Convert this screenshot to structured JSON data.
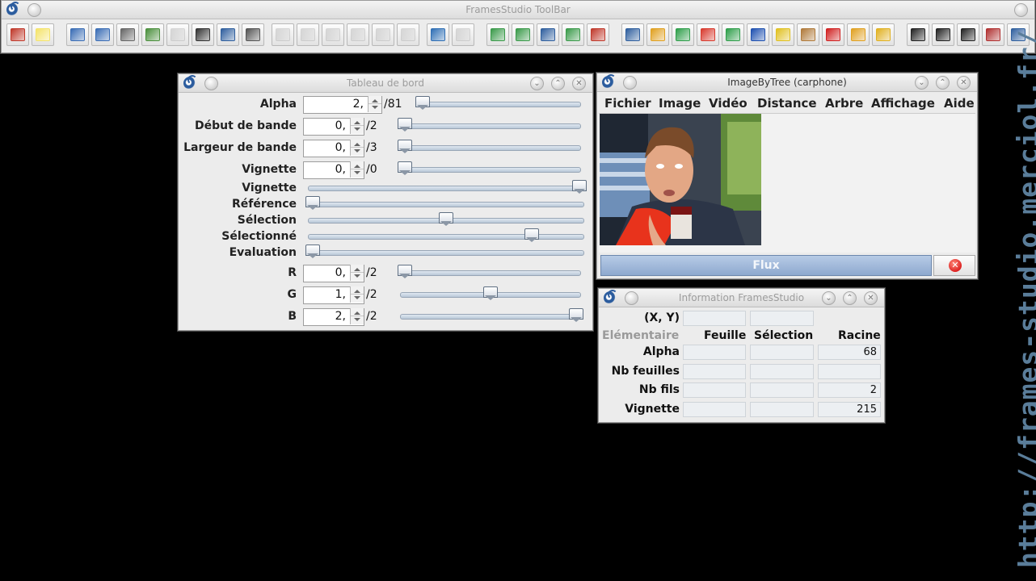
{
  "toolbar_window": {
    "title": "FramesStudio ToolBar",
    "buttons": [
      {
        "name": "exit-icon",
        "color": "#c0392b"
      },
      {
        "name": "new-document-icon",
        "color": "#f4e36a"
      },
      {
        "name": "open-image-icon",
        "color": "#3a6db5"
      },
      {
        "name": "open-sequence-icon",
        "color": "#3a6db5"
      },
      {
        "name": "camera-icon",
        "color": "#666666"
      },
      {
        "name": "screen-capture-icon",
        "color": "#4a8f3c"
      },
      {
        "name": "capture-disabled-icon",
        "color": "#9b9b9b"
      },
      {
        "name": "film-icon",
        "color": "#333333"
      },
      {
        "name": "list-icon",
        "color": "#2f5f9e"
      },
      {
        "name": "webcam-icon",
        "color": "#555555"
      },
      {
        "name": "play-icon",
        "color": "#9b9b9b"
      },
      {
        "name": "redo-icon",
        "color": "#9b9b9b"
      },
      {
        "name": "stop-icon",
        "color": "#9b9b9b"
      },
      {
        "name": "light-icon",
        "color": "#9b9b9b"
      },
      {
        "name": "pen-icon",
        "color": "#9b9b9b"
      },
      {
        "name": "hat-icon",
        "color": "#9b9b9b"
      },
      {
        "name": "resize-icon",
        "color": "#2f6fb5"
      },
      {
        "name": "chart-disabled-icon",
        "color": "#9b9b9b"
      },
      {
        "name": "tree-icon",
        "color": "#3a9a4a"
      },
      {
        "name": "tree-add-icon",
        "color": "#3a9a4a"
      },
      {
        "name": "bars-icon",
        "color": "#2f5f9e"
      },
      {
        "name": "heart-tree-icon",
        "color": "#3a9a4a"
      },
      {
        "name": "tree-remove-icon",
        "color": "#c0392b"
      },
      {
        "name": "magnifier-icon",
        "color": "#2f5f9e"
      },
      {
        "name": "color-grid-1-icon",
        "color": "#e0a020"
      },
      {
        "name": "color-grid-2-icon",
        "color": "#2e9e4a"
      },
      {
        "name": "triangle-icon",
        "color": "#d83a2e"
      },
      {
        "name": "heart-color-icon",
        "color": "#2e9e4a"
      },
      {
        "name": "color-grid-3-icon",
        "color": "#1e50b0"
      },
      {
        "name": "color-grid-4-icon",
        "color": "#e0c020"
      },
      {
        "name": "palette-icon",
        "color": "#b07a3a"
      },
      {
        "name": "pushpin-icon",
        "color": "#d02020"
      },
      {
        "name": "help-cursor-icon",
        "color": "#e0a020"
      },
      {
        "name": "filter-icon",
        "color": "#e0b020"
      },
      {
        "name": "question-bubble-icon",
        "color": "#222222"
      },
      {
        "name": "copyright-icon",
        "color": "#222222"
      },
      {
        "name": "chat-bubble-icon",
        "color": "#222222"
      },
      {
        "name": "record-icon",
        "color": "#b03030"
      },
      {
        "name": "manual-icon",
        "color": "#2f5f9e"
      }
    ]
  },
  "dashboard": {
    "title": "Tableau de bord",
    "spin_rows": [
      {
        "label": "Alpha",
        "value": "2,",
        "max": "/81",
        "level": 0
      },
      {
        "label": "Début de bande",
        "value": "0,",
        "max": "/2",
        "level": 0
      },
      {
        "label": "Largeur de bande",
        "value": "0,",
        "max": "/3",
        "level": 0
      },
      {
        "label": "Vignette",
        "value": "0,",
        "max": "/0",
        "level": 0
      }
    ],
    "slider_rows": [
      {
        "label": "Vignette",
        "level": 1.0
      },
      {
        "label": "Référence",
        "level": 0.0
      },
      {
        "label": "Sélection",
        "level": 0.5
      },
      {
        "label": "Sélectionné",
        "level": 0.82
      },
      {
        "label": "Evaluation",
        "level": 0.0
      }
    ],
    "rgb_rows": [
      {
        "label": "R",
        "value": "0,",
        "max": "/2",
        "level": 0.0
      },
      {
        "label": "G",
        "value": "1,",
        "max": "/2",
        "level": 0.5
      },
      {
        "label": "B",
        "value": "2,",
        "max": "/2",
        "level": 1.0
      }
    ]
  },
  "image_window": {
    "title": "ImageByTree (carphone)",
    "menu": [
      "Fichier",
      "Image",
      "Vidéo",
      "Distance",
      "Arbre",
      "Affichage",
      "Aide"
    ],
    "flux_label": "Flux"
  },
  "info_window": {
    "title": "Information FramesStudio",
    "xy_label": "(X, Y)",
    "headers": {
      "elementaire": "Elémentaire",
      "feuille": "Feuille",
      "selection": "Sélection",
      "racine": "Racine"
    },
    "rows": [
      {
        "label": "Alpha",
        "feuille": "",
        "selection": "",
        "racine": "68"
      },
      {
        "label": "Nb feuilles",
        "feuille": "",
        "selection": "",
        "racine": ""
      },
      {
        "label": "Nb fils",
        "feuille": "",
        "selection": "",
        "racine": "2"
      },
      {
        "label": "Vignette",
        "feuille": "",
        "selection": "",
        "racine": "215"
      }
    ]
  },
  "watermark": "http://frames-studio.merciol.fr/"
}
